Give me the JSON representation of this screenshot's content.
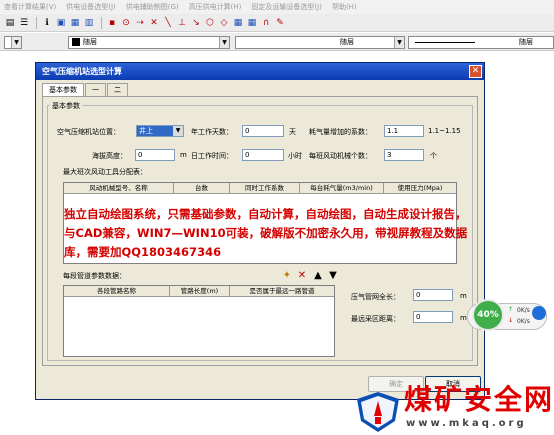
{
  "menu": [
    "查看计算结果(V)",
    "供电设备选型(J)",
    "供电辅助制图(G)",
    "高压供电计算(H)",
    "固定及运输设备选型(J)",
    "帮助(H)"
  ],
  "propbar": {
    "color": "随层",
    "linetype": "随层",
    "lineweight": "随层"
  },
  "dialog": {
    "title": "空气压缩机站选型计算",
    "tabs": [
      "基本参数",
      "一",
      "二"
    ],
    "group_label": "基本参数",
    "fields": {
      "location_label": "空气压缩机站位置：",
      "location_value": "井上",
      "work_days_label": "年工作天数：",
      "work_days_value": "0",
      "work_days_unit": "天",
      "air_coef_label": "耗气量增加的系数：",
      "air_coef_value": "1.1",
      "air_coef_range": "1.1~1.15",
      "altitude_label": "海拔高度：",
      "altitude_value": "0",
      "altitude_unit": "m",
      "daily_hours_label": "日工作时间：",
      "daily_hours_value": "0",
      "daily_hours_unit": "小时",
      "tool_count_label": "每班风动机械个数：",
      "tool_count_value": "3",
      "tool_count_unit": "个",
      "max_shift_label": "最大班次风动工具分配表：",
      "pipe_section_label": "每段管道参数数据：",
      "pipe_total_label": "压气管网全长：",
      "pipe_total_value": "0",
      "pipe_total_unit": "m",
      "farthest_label": "最远采区距离：",
      "farthest_value": "0",
      "farthest_unit": "m"
    },
    "tool_table_columns": [
      "风动机械型号、名称",
      "台数",
      "同时工作系数",
      "每台耗气量(m3/min)",
      "使用压力(Mpa)"
    ],
    "pipe_table_columns": [
      "各段管路名称",
      "管路长度(m)",
      "是否属于最远一路管道"
    ],
    "ok_label": "确定",
    "cancel_label": "取消"
  },
  "ad_text": "独立自动绘图系统，只需基础参数，自动计算，自动绘图，自动生成设计报告，与CAD兼容，WIN7—WIN10可装，破解版不加密永久用，带视屏教程及数据库，需要加QQ1803467346",
  "network": {
    "percent": "40%",
    "up": "0K/s",
    "down": "0K/s"
  },
  "watermark": {
    "name": "煤矿安全网",
    "url": "www.mkaq.org"
  }
}
